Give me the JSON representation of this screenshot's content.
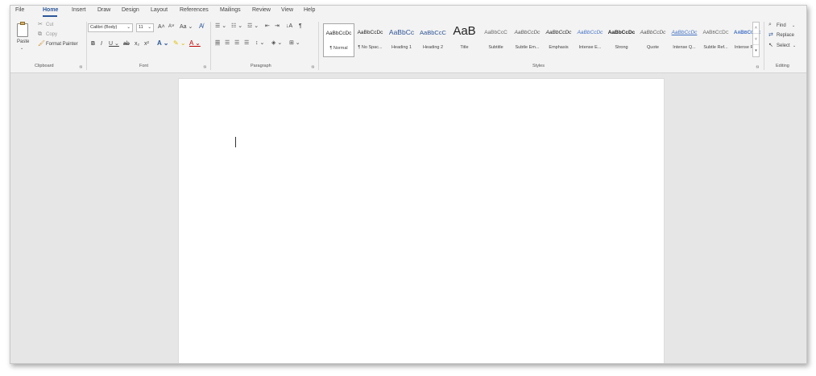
{
  "tabs": [
    "File",
    "Home",
    "Insert",
    "Draw",
    "Design",
    "Layout",
    "References",
    "Mailings",
    "Review",
    "View",
    "Help"
  ],
  "active_tab": "Home",
  "clipboard": {
    "paste": "Paste",
    "cut": "Cut",
    "copy": "Copy",
    "format_painter": "Format Painter",
    "group": "Clipboard"
  },
  "font": {
    "family": "Calibri (Body)",
    "size": "11",
    "group": "Font"
  },
  "paragraph": {
    "group": "Paragraph"
  },
  "styles": {
    "group": "Styles",
    "items": [
      {
        "sample": "AaBbCcDc",
        "name": "¶ Normal"
      },
      {
        "sample": "AaBbCcDc",
        "name": "¶ No Spac..."
      },
      {
        "sample": "AaBbCc",
        "name": "Heading 1"
      },
      {
        "sample": "AaBbCcC",
        "name": "Heading 2"
      },
      {
        "sample": "AaB",
        "name": "Title"
      },
      {
        "sample": "AaBbCcC",
        "name": "Subtitle"
      },
      {
        "sample": "AaBbCcDc",
        "name": "Subtle Em..."
      },
      {
        "sample": "AaBbCcDc",
        "name": "Emphasis"
      },
      {
        "sample": "AaBbCcDc",
        "name": "Intense E..."
      },
      {
        "sample": "AaBbCcDc",
        "name": "Strong"
      },
      {
        "sample": "AaBbCcDc",
        "name": "Quote"
      },
      {
        "sample": "AaBbCcDc",
        "name": "Intense Q..."
      },
      {
        "sample": "AaBbCcDc",
        "name": "Subtle Ref..."
      },
      {
        "sample": "AaBbCcDc",
        "name": "Intense Re..."
      }
    ]
  },
  "editing": {
    "find": "Find",
    "replace": "Replace",
    "select": "Select",
    "group": "Editing"
  },
  "colors": {
    "accent": "#2b579a",
    "ribbon_bg": "#f3f3f3",
    "canvas_bg": "#e6e6e6"
  }
}
